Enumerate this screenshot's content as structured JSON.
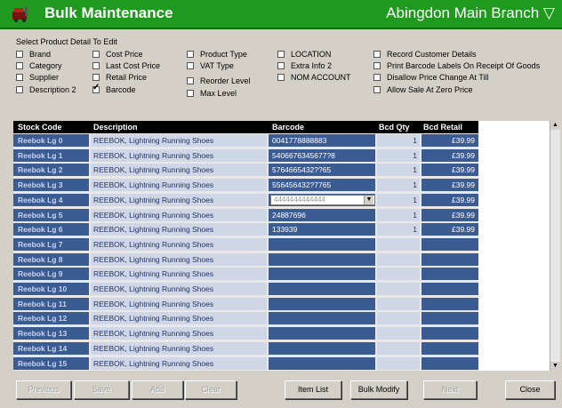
{
  "window": {
    "title": "Bulk Maintenance",
    "branch": "Abingdon Main Branch",
    "branch_suffix": "▽",
    "title_bar_color": "#1f9a1f"
  },
  "options": {
    "heading": "Select Product Detail To Edit",
    "items": [
      {
        "label": "Brand",
        "checked": false
      },
      {
        "label": "Category",
        "checked": false
      },
      {
        "label": "Supplier",
        "checked": false
      },
      {
        "label": "Description 2",
        "checked": false
      },
      {
        "label": "Cost Price",
        "checked": false
      },
      {
        "label": "Last Cost Price",
        "checked": false
      },
      {
        "label": "Retail Price",
        "checked": false
      },
      {
        "label": "Barcode",
        "checked": true
      },
      {
        "label": "Product Type",
        "checked": false
      },
      {
        "label": "VAT Type",
        "checked": false
      },
      {
        "label": "Reorder Level",
        "checked": false
      },
      {
        "label": "Max Level",
        "checked": false
      },
      {
        "label": "LOCATION",
        "checked": false
      },
      {
        "label": "Extra Info 2",
        "checked": false
      },
      {
        "label": "NOM ACCOUNT",
        "checked": false
      },
      {
        "label": "Record Customer Details",
        "checked": false
      },
      {
        "label": "Print Barcode Labels On Receipt Of Goods",
        "checked": false
      },
      {
        "label": "Disallow Price Change At Till",
        "checked": false
      },
      {
        "label": "Allow Sale At Zero Price",
        "checked": false
      }
    ]
  },
  "grid": {
    "columns": [
      "Stock Code",
      "Description",
      "Barcode",
      "Bcd Qty",
      "Bcd Retail"
    ],
    "rows": [
      {
        "code": "Reebok Lg 0",
        "desc": "REEBOK, Lightning Running Shoes",
        "barcode": "0041778888883",
        "qty": "1",
        "retail": "£39.99",
        "dropdown": false
      },
      {
        "code": "Reebok Lg 1",
        "desc": "REEBOK, Lightning Running Shoes",
        "barcode": "5406676345677?8",
        "qty": "1",
        "retail": "£39.99",
        "dropdown": false
      },
      {
        "code": "Reebok Lg 2",
        "desc": "REEBOK, Lightning Running Shoes",
        "barcode": "5764665432??65",
        "qty": "1",
        "retail": "£39.99",
        "dropdown": false
      },
      {
        "code": "Reebok Lg 3",
        "desc": "REEBOK, Lightning Running Shoes",
        "barcode": "556456432?7765",
        "qty": "1",
        "retail": "£39.99",
        "dropdown": false
      },
      {
        "code": "Reebok Lg 4",
        "desc": "REEBOK, Lightning Running Shoes",
        "barcode": "4444444444444",
        "qty": "1",
        "retail": "£39.99",
        "dropdown": true
      },
      {
        "code": "Reebok Lg 5",
        "desc": "REEBOK, Lightning Running Shoes",
        "barcode": "24887696",
        "qty": "1",
        "retail": "£39.99",
        "dropdown": false
      },
      {
        "code": "Reebok Lg 6",
        "desc": "REEBOK, Lightning Running Shoes",
        "barcode": "133939",
        "qty": "1",
        "retail": "£39.99",
        "dropdown": false
      },
      {
        "code": "Reebok Lg 7",
        "desc": "REEBOK, Lightning Running Shoes",
        "barcode": "",
        "qty": "",
        "retail": "",
        "dropdown": false
      },
      {
        "code": "Reebok Lg 8",
        "desc": "REEBOK, Lightning Running Shoes",
        "barcode": "",
        "qty": "",
        "retail": "",
        "dropdown": false
      },
      {
        "code": "Reebok Lg 9",
        "desc": "REEBOK, Lightning Running Shoes",
        "barcode": "",
        "qty": "",
        "retail": "",
        "dropdown": false
      },
      {
        "code": "Reebok Lg 10",
        "desc": "REEBOK, Lightning Running Shoes",
        "barcode": "",
        "qty": "",
        "retail": "",
        "dropdown": false
      },
      {
        "code": "Reebok Lg 11",
        "desc": "REEBOK, Lightning Running Shoes",
        "barcode": "",
        "qty": "",
        "retail": "",
        "dropdown": false
      },
      {
        "code": "Reebok Lg 12",
        "desc": "REEBOK, Lightning Running Shoes",
        "barcode": "",
        "qty": "",
        "retail": "",
        "dropdown": false
      },
      {
        "code": "Reebok Lg 13",
        "desc": "REEBOK, Lightning Running Shoes",
        "barcode": "",
        "qty": "",
        "retail": "",
        "dropdown": false
      },
      {
        "code": "Reebok Lg 14",
        "desc": "REEBOK, Lightning Running Shoes",
        "barcode": "",
        "qty": "",
        "retail": "",
        "dropdown": false
      },
      {
        "code": "Reebok Lg 15",
        "desc": "REEBOK, Lightning Running Shoes",
        "barcode": "",
        "qty": "",
        "retail": "",
        "dropdown": false
      }
    ]
  },
  "buttons": [
    {
      "label": "Previous",
      "enabled": false
    },
    {
      "label": "Save",
      "enabled": false
    },
    {
      "label": "Add",
      "enabled": false
    },
    {
      "label": "Clear",
      "enabled": false
    },
    {
      "label": "Item List",
      "enabled": true
    },
    {
      "label": "Bulk Modify",
      "enabled": true
    },
    {
      "label": "Next",
      "enabled": false
    },
    {
      "label": "Close",
      "enabled": true
    }
  ]
}
